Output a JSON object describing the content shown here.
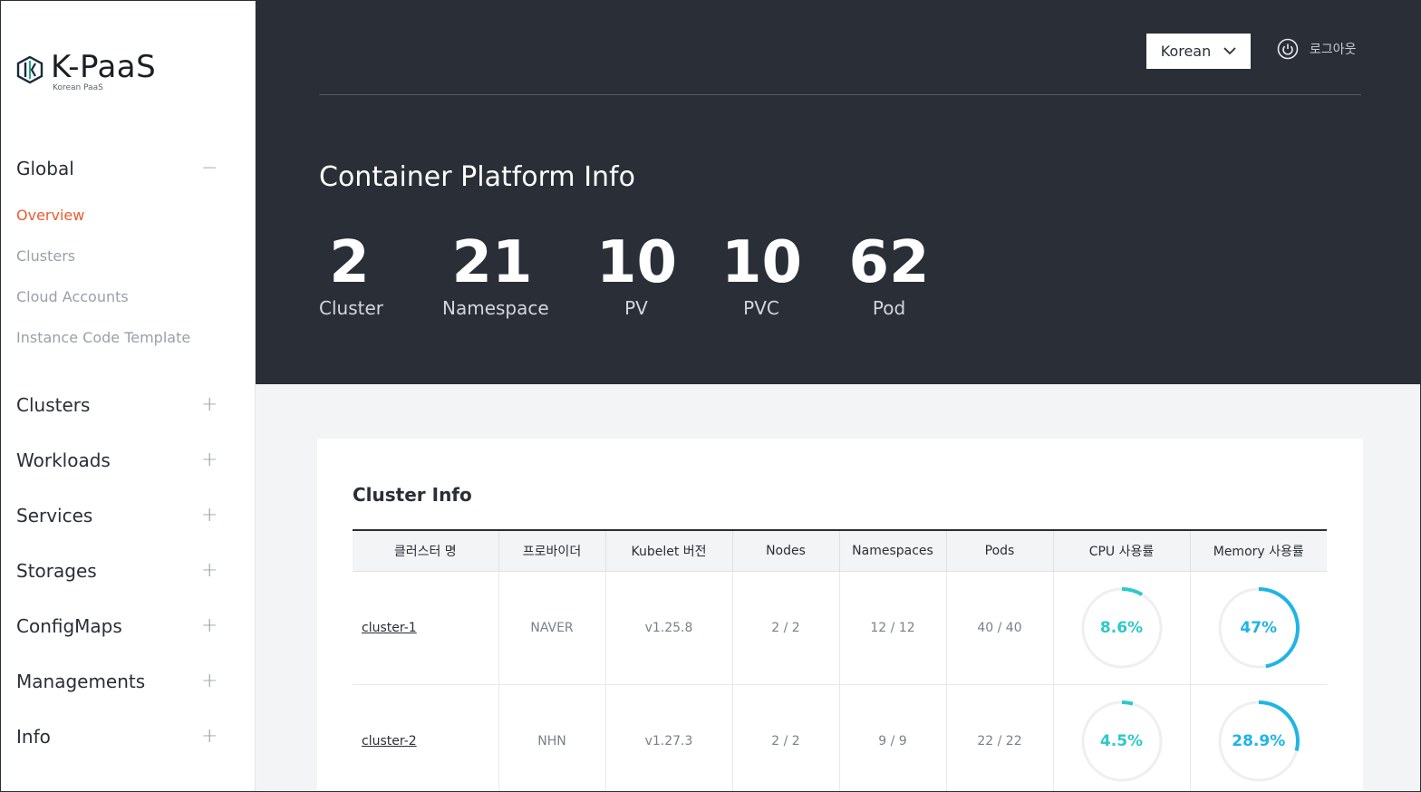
{
  "sidebar": {
    "logo": {
      "name": "K-PaaS",
      "sub": "Korean PaaS"
    },
    "global": {
      "label": "Global",
      "toggle": "−"
    },
    "global_items": [
      {
        "label": "Overview"
      },
      {
        "label": "Clusters"
      },
      {
        "label": "Cloud Accounts"
      },
      {
        "label": "Instance Code Template"
      }
    ],
    "sections": [
      {
        "label": "Clusters",
        "toggle": "+"
      },
      {
        "label": "Workloads",
        "toggle": "+"
      },
      {
        "label": "Services",
        "toggle": "+"
      },
      {
        "label": "Storages",
        "toggle": "+"
      },
      {
        "label": "ConfigMaps",
        "toggle": "+"
      },
      {
        "label": "Managements",
        "toggle": "+"
      },
      {
        "label": "Info",
        "toggle": "+"
      }
    ]
  },
  "header": {
    "language": "Korean",
    "logout": "로그아웃",
    "title": "Container Platform Info"
  },
  "stats": [
    {
      "value": "2",
      "label": "Cluster"
    },
    {
      "value": "21",
      "label": "Namespace"
    },
    {
      "value": "10",
      "label": "PV"
    },
    {
      "value": "10",
      "label": "PVC"
    },
    {
      "value": "62",
      "label": "Pod"
    }
  ],
  "cluster_info": {
    "title": "Cluster Info",
    "columns": [
      "클러스터 명",
      "프로바이더",
      "Kubelet 버전",
      "Nodes",
      "Namespaces",
      "Pods",
      "CPU 사용률",
      "Memory 사용률"
    ],
    "rows": [
      {
        "name": "cluster-1",
        "provider": "NAVER",
        "kubelet": "v1.25.8",
        "nodes": "2 / 2",
        "namespaces": "12 / 12",
        "pods": "40 / 40",
        "cpu": 8.6,
        "cpu_label": "8.6%",
        "memory": 47,
        "memory_label": "47%"
      },
      {
        "name": "cluster-2",
        "provider": "NHN",
        "kubelet": "v1.27.3",
        "nodes": "2 / 2",
        "namespaces": "9 / 9",
        "pods": "22 / 22",
        "cpu": 4.5,
        "cpu_label": "4.5%",
        "memory": 28.9,
        "memory_label": "28.9%"
      }
    ]
  },
  "colors": {
    "accent": "#ee5a2e",
    "dark": "#2a2e37",
    "cpu": "#2dc9c9",
    "memory": "#1fb4e6",
    "track": "#eeeff1"
  }
}
